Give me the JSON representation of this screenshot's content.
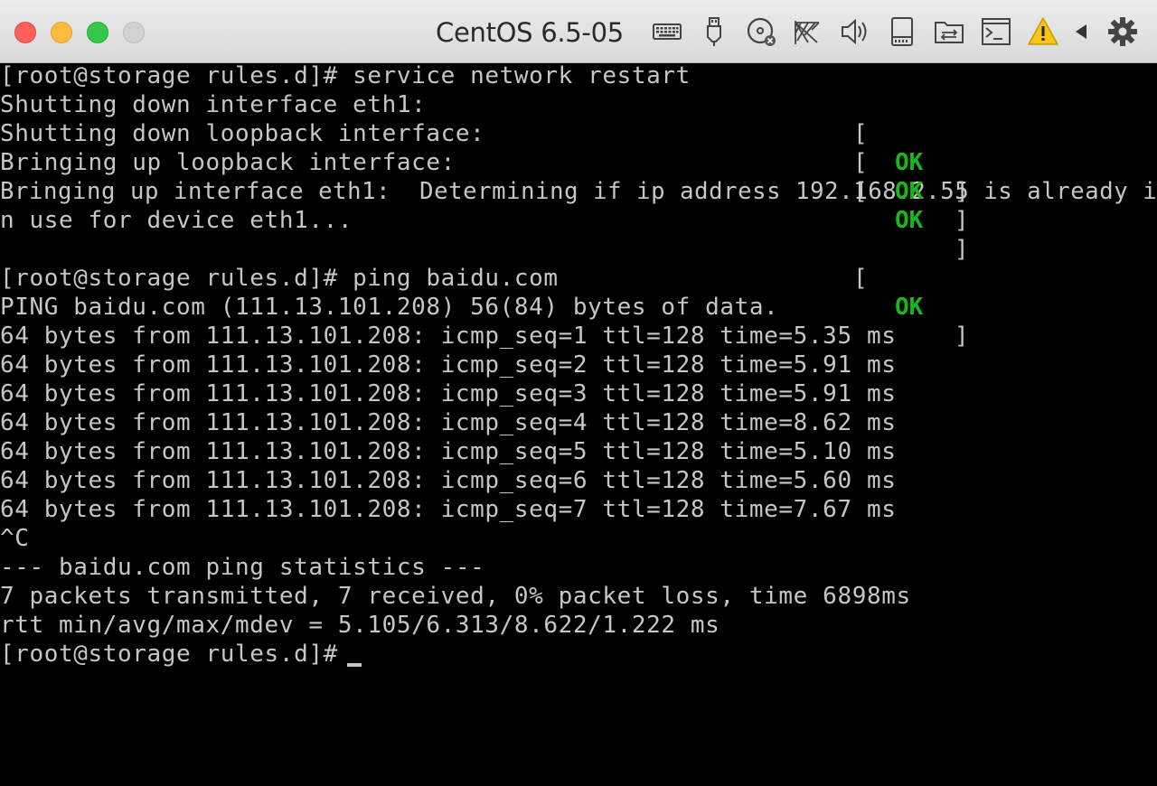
{
  "window": {
    "title": "CentOS 6.5-05"
  },
  "toolbar": {
    "icons": [
      "keyboard-icon",
      "usb-icon",
      "optical-disk-icon",
      "network-icon",
      "audio-icon",
      "hard-disk-icon",
      "shared-folder-icon",
      "console-icon",
      "warning-icon",
      "back-icon",
      "settings-icon"
    ]
  },
  "terminal": {
    "lines": [
      "[root@storage rules.d]# service network restart",
      "Shutting down interface eth1:",
      "Shutting down loopback interface:",
      "Bringing up loopback interface:",
      "Bringing up interface eth1:  Determining if ip address 192.168.2.55 is already i",
      "n use for device eth1...",
      "",
      "[root@storage rules.d]# ping baidu.com",
      "PING baidu.com (111.13.101.208) 56(84) bytes of data.",
      "64 bytes from 111.13.101.208: icmp_seq=1 ttl=128 time=5.35 ms",
      "64 bytes from 111.13.101.208: icmp_seq=2 ttl=128 time=5.91 ms",
      "64 bytes from 111.13.101.208: icmp_seq=3 ttl=128 time=5.91 ms",
      "64 bytes from 111.13.101.208: icmp_seq=4 ttl=128 time=8.62 ms",
      "64 bytes from 111.13.101.208: icmp_seq=5 ttl=128 time=5.10 ms",
      "64 bytes from 111.13.101.208: icmp_seq=6 ttl=128 time=5.60 ms",
      "64 bytes from 111.13.101.208: icmp_seq=7 ttl=128 time=7.67 ms",
      "^C",
      "--- baidu.com ping statistics ---",
      "7 packets transmitted, 7 received, 0% packet loss, time 6898ms",
      "rtt min/avg/max/mdev = 5.105/6.313/8.622/1.222 ms",
      "[root@storage rules.d]# "
    ],
    "status_open": "[",
    "status_ok": "OK",
    "status_close": "]",
    "ok_color": "#18b818",
    "text_color": "#c6c6c6"
  }
}
